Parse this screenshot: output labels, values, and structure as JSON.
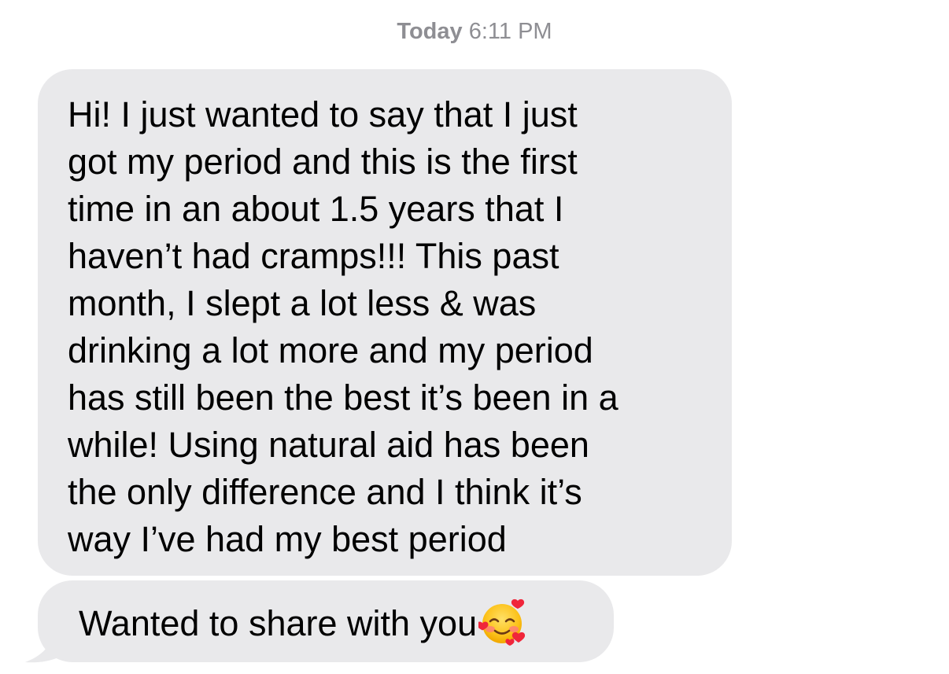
{
  "conversation": {
    "timestamp": {
      "day": "Today",
      "time": "6:11 PM"
    },
    "messages": [
      {
        "direction": "received",
        "lines": [
          "Hi! I just wanted to say that I just",
          "got my period and this is the first",
          "time in an about 1.5 years that I",
          "haven’t had cramps!!! This past",
          "month, I slept a lot less & was",
          "drinking a lot more and my period",
          "has still been the best it’s been in a",
          "while! Using natural aid has been",
          "the only difference and I think it’s",
          "way I’ve had my best period"
        ]
      },
      {
        "direction": "received",
        "text": "Wanted to share with you",
        "emoji": "smiling-face-with-hearts-icon"
      }
    ]
  },
  "colors": {
    "received_bubble": "#e9e9eb",
    "timestamp_text": "#8e8e93",
    "background": "#ffffff"
  }
}
